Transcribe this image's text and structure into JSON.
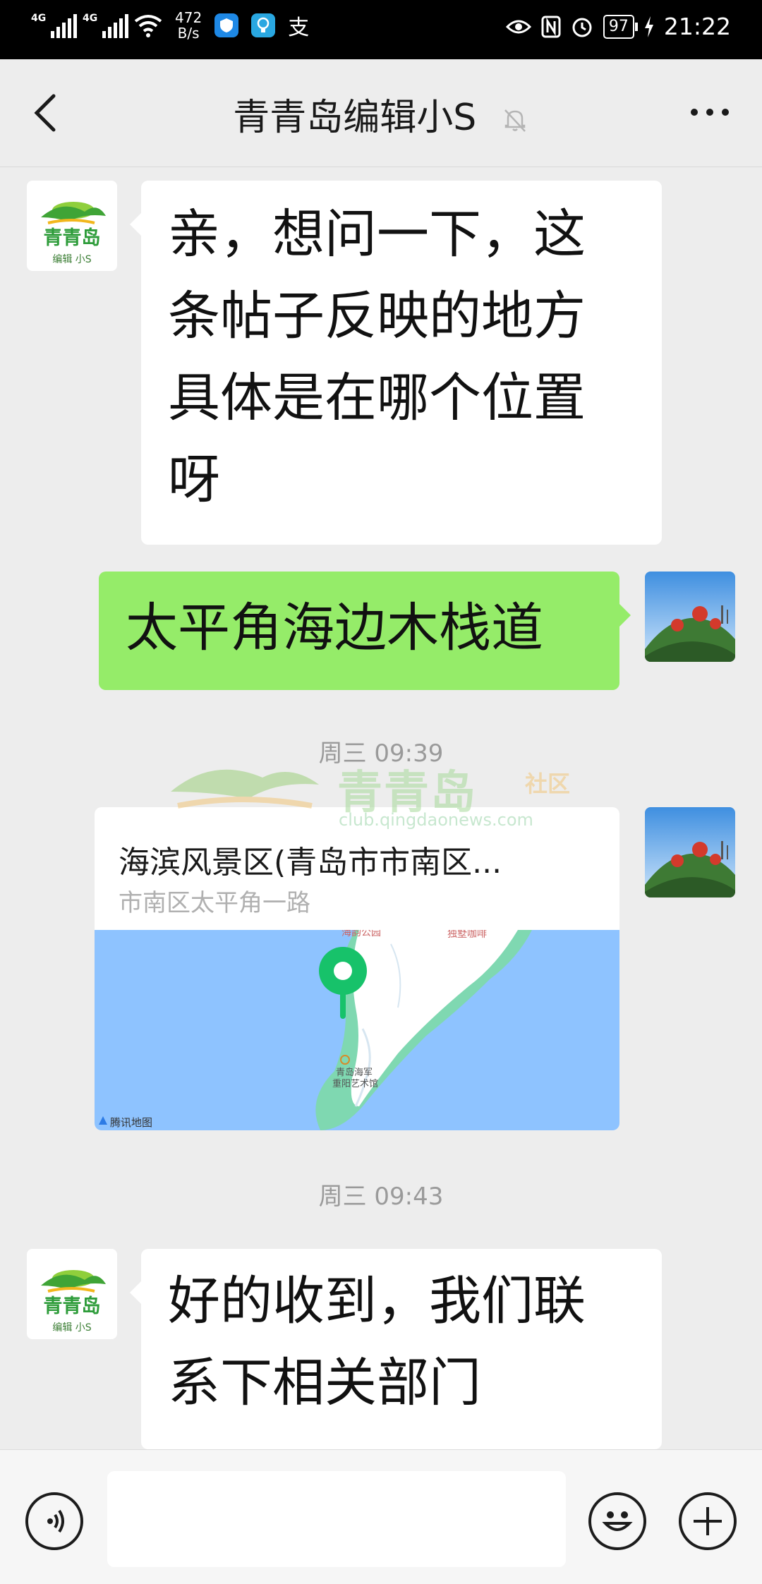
{
  "status_bar": {
    "signal1": "4G",
    "signal2": "4G",
    "net_speed_value": "472",
    "net_speed_unit": "B/s",
    "battery": "97",
    "time": "21:22",
    "app_icons": [
      "shield-icon",
      "bulb-icon",
      "alipay-icon"
    ],
    "right_icons": [
      "eye-icon",
      "nfc-icon",
      "alarm-icon",
      "battery-icon",
      "charging-icon"
    ]
  },
  "header": {
    "title": "青青岛编辑小S",
    "muted": true
  },
  "messages": [
    {
      "side": "left",
      "text_lines": [
        "亲，想问一下，这",
        "条帖子反映的地方",
        "具体是在哪个位置",
        "呀"
      ]
    },
    {
      "side": "right",
      "text_lines": [
        "太平角海边木栈道"
      ]
    },
    {
      "type": "timestamp",
      "text": "周三 09:39"
    },
    {
      "side": "right",
      "type": "location",
      "name": "海滨风景区(青岛市市南区...",
      "address": "市南区太平角一路",
      "map_labels": [
        "青岛海军",
        "重阳艺术馆",
        "腾讯地图",
        "独墅咖啡",
        "海韵公园"
      ]
    },
    {
      "type": "timestamp",
      "text": "周三 09:43"
    },
    {
      "side": "left",
      "text_lines": [
        "好的收到，我们联",
        "系下相关部门"
      ]
    }
  ],
  "watermark": {
    "brand": "青青岛",
    "suffix": "社区",
    "url": "club.qingdaonews.com"
  },
  "avatar_brand": {
    "name": "青青岛",
    "sub": "编辑 小S"
  },
  "colors": {
    "chat_bg": "#ededed",
    "sent_bubble": "#95ec69",
    "received_bubble": "#ffffff",
    "timestamp": "#9a9a9a",
    "map_water": "#8ec3ff",
    "map_land": "#ffffff",
    "map_shore": "#7fd8b1",
    "pin": "#17c26a"
  },
  "input_bar": {
    "icons": [
      "voice-icon",
      "emoji-icon",
      "plus-icon"
    ],
    "placeholder": ""
  }
}
